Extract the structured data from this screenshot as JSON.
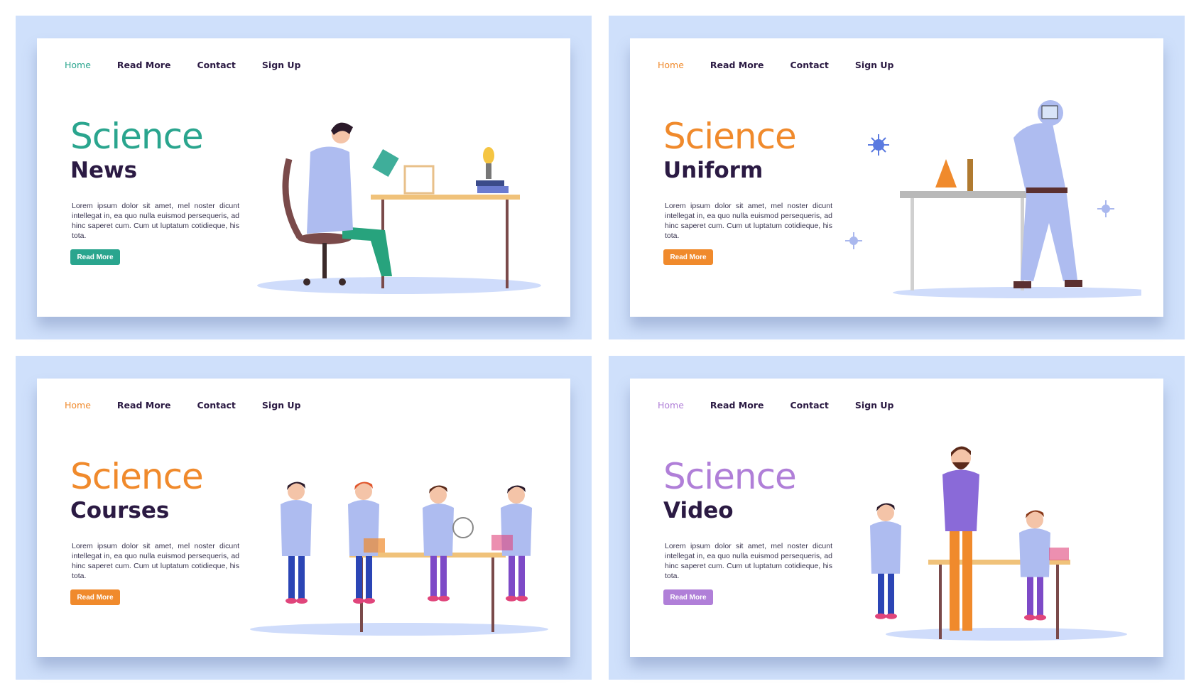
{
  "panels": [
    {
      "nav": [
        "Home",
        "Read More",
        "Contact",
        "Sign Up"
      ],
      "title": "Science",
      "subtitle": "News",
      "body": "Lorem ipsum dolor sit amet, mel noster dicunt intellegat in, ea quo nulla euismod persequeris, ad hinc saperet cum. Cum ut luptatum cotidieque, his tota.",
      "button": "Read More",
      "accent": "#2aa58e",
      "scene": "reading-scientist"
    },
    {
      "nav": [
        "Home",
        "Read More",
        "Contact",
        "Sign Up"
      ],
      "title": "Science",
      "subtitle": "Uniform",
      "body": "Lorem ipsum dolor sit amet, mel noster dicunt intellegat in, ea quo nulla euismod persequeris, ad hinc saperet cum. Cum ut luptatum cotidieque, his tota.",
      "button": "Read More",
      "accent": "#f08a2c",
      "scene": "hazmat-scientist"
    },
    {
      "nav": [
        "Home",
        "Read More",
        "Contact",
        "Sign Up"
      ],
      "title": "Science",
      "subtitle": "Courses",
      "body": "Lorem ipsum dolor sit amet, mel noster dicunt intellegat in, ea quo nulla euismod persequeris, ad hinc saperet cum. Cum ut luptatum cotidieque, his tota.",
      "button": "Read More",
      "accent": "#f08a2c",
      "scene": "students-lab"
    },
    {
      "nav": [
        "Home",
        "Read More",
        "Contact",
        "Sign Up"
      ],
      "title": "Science",
      "subtitle": "Video",
      "body": "Lorem ipsum dolor sit amet, mel noster dicunt intellegat in, ea quo nulla euismod persequeris, ad hinc saperet cum. Cum ut luptatum cotidieque, his tota.",
      "button": "Read More",
      "accent": "#b07fd8",
      "scene": "teacher-kids"
    }
  ],
  "colors": {
    "background": "#cfe0fb",
    "heading_dark": "#2b1a43",
    "coat": "#aebcf0"
  }
}
